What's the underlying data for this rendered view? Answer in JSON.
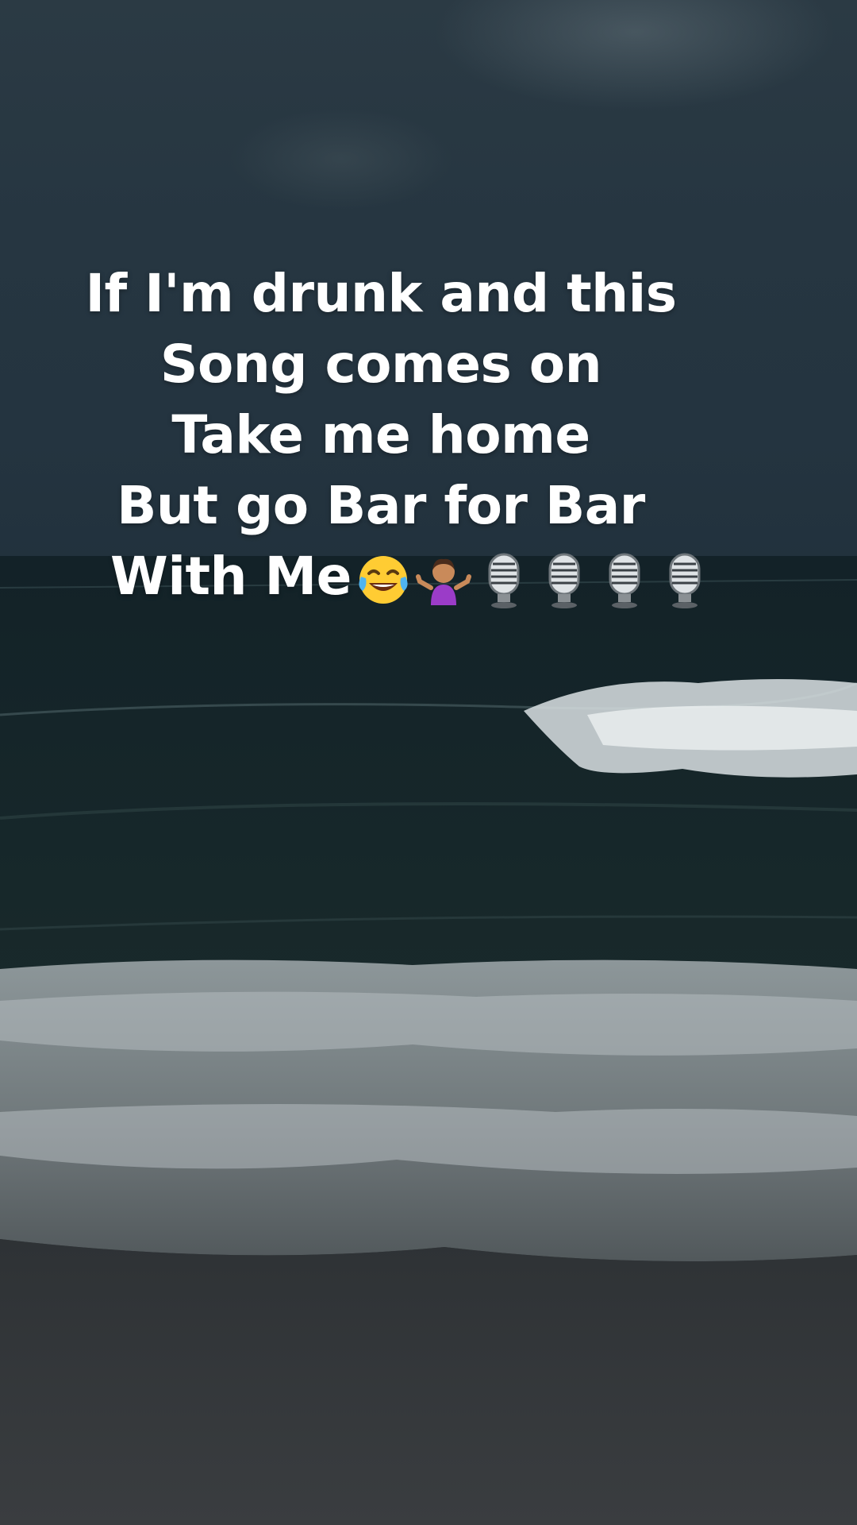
{
  "caption": {
    "lines": [
      "If I'm drunk and this",
      "Song comes on",
      "Take me home",
      "But go Bar for Bar",
      "With Me"
    ],
    "trailing_emojis": [
      "tears-of-joy-emoji",
      "shrugging-woman-emoji",
      "microphone-emoji",
      "microphone-emoji",
      "microphone-emoji",
      "microphone-emoji"
    ]
  },
  "scene": {
    "subject": "dark sea with breaking waves under an overcast sky",
    "sky_color": "#263641",
    "sea_color": "#16252a",
    "foam_color": "#e8eef0"
  }
}
